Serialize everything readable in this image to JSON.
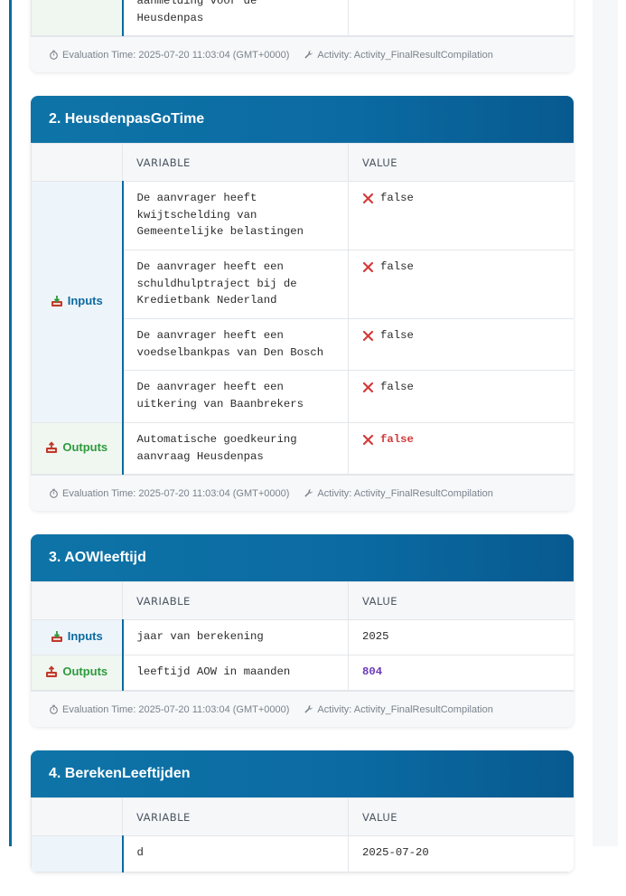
{
  "cards": [
    {
      "title": "",
      "partial_rows": [
        {
          "variable": "aanmelding voor de\nHeusdenpas",
          "value": ""
        }
      ],
      "footer": {
        "evaluation_time": "Evaluation Time: 2025-07-20 11:03:04 (GMT+0000)",
        "activity": "Activity: Activity_FinalResultCompilation"
      }
    },
    {
      "title": "2. HeusdenpasGoTime",
      "columns": {
        "category": "",
        "variable": "VARIABLE",
        "value": "VALUE"
      },
      "inputs_label": "Inputs",
      "outputs_label": "Outputs",
      "inputs": [
        {
          "variable": "De aanvrager heeft kwijtschelding van Gemeentelijke belastingen",
          "value": "false"
        },
        {
          "variable": "De aanvrager heeft een schuldhulptraject bij de Kredietbank Nederland",
          "value": "false"
        },
        {
          "variable": "De aanvrager heeft een voedselbankpas van Den Bosch",
          "value": "false"
        },
        {
          "variable": "De aanvrager heeft een uitkering van Baanbrekers",
          "value": "false"
        }
      ],
      "outputs": [
        {
          "variable": "Automatische goedkeuring aanvraag Heusdenpas",
          "value": "false"
        }
      ],
      "footer": {
        "evaluation_time": "Evaluation Time: 2025-07-20 11:03:04 (GMT+0000)",
        "activity": "Activity: Activity_FinalResultCompilation"
      }
    },
    {
      "title": "3. AOWleeftijd",
      "columns": {
        "category": "",
        "variable": "VARIABLE",
        "value": "VALUE"
      },
      "inputs_label": "Inputs",
      "outputs_label": "Outputs",
      "inputs": [
        {
          "variable": "jaar van berekening",
          "value": "2025"
        }
      ],
      "outputs": [
        {
          "variable": "leeftijd AOW in maanden",
          "value": "804"
        }
      ],
      "footer": {
        "evaluation_time": "Evaluation Time: 2025-07-20 11:03:04 (GMT+0000)",
        "activity": "Activity: Activity_FinalResultCompilation"
      }
    },
    {
      "title": "4. BerekenLeeftijden",
      "columns": {
        "category": "",
        "variable": "VARIABLE",
        "value": "VALUE"
      },
      "partial_first_row": {
        "variable": "d",
        "value": "2025-07-20"
      }
    }
  ],
  "colors": {
    "accent": "#0b6aa2",
    "inputs": "#0b6aa2",
    "outputs": "#2e9a3e",
    "false_icon": "#d33a3a",
    "number_output": "#6a3ab8"
  },
  "icons": {
    "inputs": "inbox-download-icon",
    "outputs": "inbox-upload-icon",
    "false": "x-mark-icon",
    "time": "stopwatch-icon",
    "activity": "wrench-icon"
  }
}
